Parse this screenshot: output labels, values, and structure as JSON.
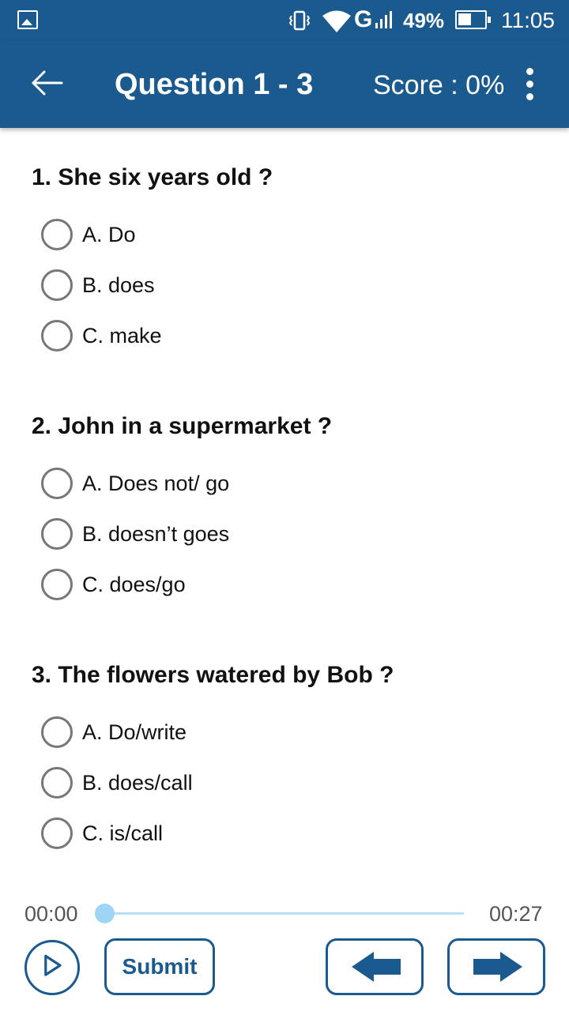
{
  "status_bar": {
    "icons": [
      "image-icon",
      "vibrate-icon",
      "wifi-icon",
      "signal-icon",
      "battery-icon"
    ],
    "network": "G",
    "battery": "49%",
    "time": "11:05"
  },
  "app_bar": {
    "back_icon": "arrow-left-icon",
    "title": "Question 1 - 3",
    "score": "Score : 0%",
    "menu_icon": "more-vert-icon",
    "color": "#1a5a8f"
  },
  "questions": [
    {
      "text": "1. She six years old ?",
      "options": [
        "A. Do",
        "B. does",
        "C. make"
      ]
    },
    {
      "text": "2. John in a supermarket ?",
      "options": [
        "A. Does not/ go",
        "B. doesn’t goes",
        "C. does/go"
      ]
    },
    {
      "text": "3. The flowers  watered by Bob ?",
      "options": [
        "A. Do/write",
        "B. does/call",
        "C. is/call"
      ]
    }
  ],
  "player": {
    "current_time": "00:00",
    "total_time": "00:27",
    "progress": 0,
    "play_icon": "play-icon"
  },
  "buttons": {
    "submit": "Submit",
    "prev_icon": "arrow-left-bold-icon",
    "next_icon": "arrow-right-bold-icon"
  }
}
